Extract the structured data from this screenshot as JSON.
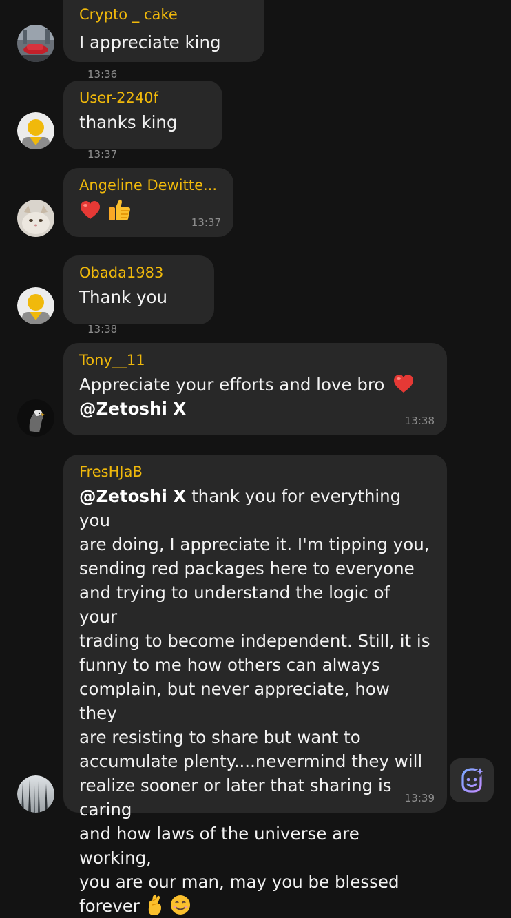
{
  "messages": [
    {
      "name": "Crypto _ cake",
      "text": "I appreciate king",
      "time": "13:36"
    },
    {
      "name": "User-2240f",
      "text": "thanks king",
      "time": "13:37"
    },
    {
      "name": "Angeline Dewitte...",
      "emoji": [
        "heart-emoji",
        "thumbs-up-emoji"
      ],
      "time": "13:37"
    },
    {
      "name": "Obada1983",
      "text": "Thank you",
      "time": "13:38"
    },
    {
      "name": "Tony__11",
      "text": "Appreciate your efforts and love bro",
      "mention": "@Zetoshi X",
      "time": "13:38"
    },
    {
      "name": "FresHJaB",
      "mention": "@Zetoshi X",
      "lines": [
        " thank you for everything you",
        "are doing, I appreciate it. I'm tipping you,",
        "sending red packages here to everyone",
        "and trying to understand the logic of your",
        "trading to become independent. Still, it is",
        "funny to me how others can always",
        "complain, but never appreciate, how they",
        "are resisting to share but want to",
        "accumulate plenty....nevermind they will",
        "realize sooner or later that sharing is caring",
        "and how laws of the universe are working,",
        "you are our man, may you be blessed",
        "forever"
      ],
      "time": "13:39"
    }
  ],
  "assistant_button": {
    "icon": "ai-assistant-icon"
  }
}
